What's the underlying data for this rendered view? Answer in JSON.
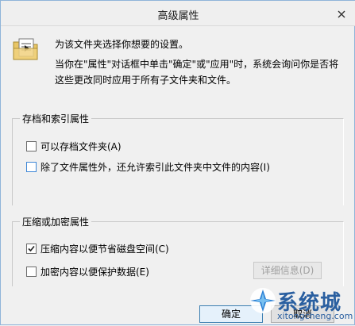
{
  "window": {
    "title": "高级属性"
  },
  "intro": {
    "line1": "为该文件夹选择你想要的设置。",
    "line2": "当你在\"属性\"对话框中单击\"确定\"或\"应用\"时，系统会询问你是否将这些更改同时应用于所有子文件夹和文件。"
  },
  "archive_index": {
    "title": "存档和索引属性",
    "options": [
      {
        "label": "可以存档文件夹(A)",
        "checked": false
      },
      {
        "label": "除了文件属性外，还允许索引此文件夹中文件的内容(I)",
        "checked": false
      }
    ]
  },
  "compress_encrypt": {
    "title": "压缩或加密属性",
    "options": [
      {
        "label": "压缩内容以便节省磁盘空间(C)",
        "checked": true
      },
      {
        "label": "加密内容以便保护数据(E)",
        "checked": false
      }
    ],
    "details_button": "详细信息(D)"
  },
  "footer": {
    "ok_label": "确定",
    "cancel_label": "取消"
  },
  "watermark": {
    "brand": "系统城",
    "url": "xitongcheng.com"
  }
}
